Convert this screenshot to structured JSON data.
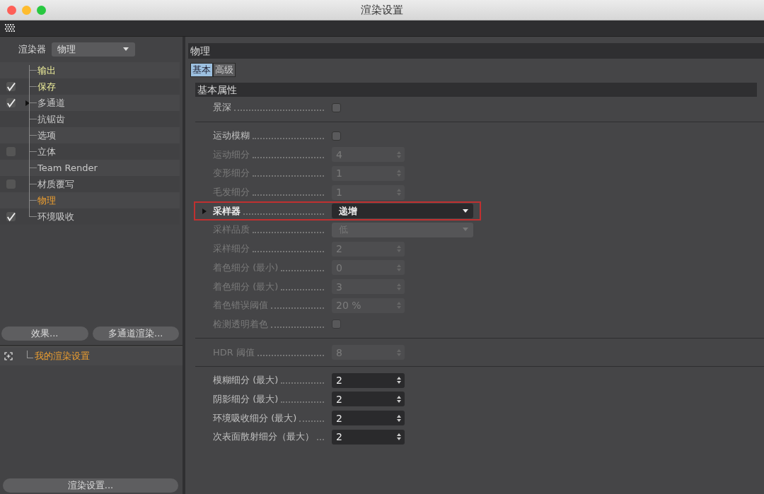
{
  "window": {
    "title": "渲染设置"
  },
  "renderer": {
    "label": "渲染器",
    "value": "物理"
  },
  "sidebar": {
    "items": [
      {
        "label": "输出",
        "kind": "plain",
        "highlighted": true,
        "selected": false
      },
      {
        "label": "保存",
        "kind": "toggle",
        "checked": true,
        "highlighted": true,
        "selected": false
      },
      {
        "label": "多通道",
        "kind": "toggle",
        "checked": true,
        "highlighted": false,
        "selected": false,
        "expandable": true
      },
      {
        "label": "抗锯齿",
        "kind": "plain",
        "highlighted": false,
        "selected": false
      },
      {
        "label": "选项",
        "kind": "plain",
        "highlighted": false,
        "selected": false
      },
      {
        "label": "立体",
        "kind": "toggle",
        "checked": false,
        "highlighted": false,
        "selected": false
      },
      {
        "label": "Team Render",
        "kind": "plain",
        "highlighted": false,
        "selected": false
      },
      {
        "label": "材质覆写",
        "kind": "toggle",
        "checked": false,
        "highlighted": false,
        "selected": false
      },
      {
        "label": "物理",
        "kind": "plain",
        "highlighted": false,
        "selected": true
      },
      {
        "label": "环境吸收",
        "kind": "toggle",
        "checked": true,
        "highlighted": false,
        "selected": false
      }
    ],
    "buttons": [
      "效果...",
      "多通道渲染..."
    ],
    "presets": [
      {
        "label": "我的渲染设置",
        "selected": true
      }
    ],
    "bottom_button": "渲染设置..."
  },
  "panel": {
    "title": "物理",
    "tabs": [
      {
        "label": "基本",
        "selected": true
      },
      {
        "label": "高级",
        "selected": false
      }
    ],
    "section": "基本属性",
    "groups": [
      [
        {
          "label": "景深",
          "kind": "checkbox",
          "checked": false,
          "disabled": false
        }
      ],
      [
        {
          "label": "运动模糊",
          "kind": "checkbox",
          "checked": false,
          "disabled": false
        },
        {
          "label": "运动细分",
          "kind": "spinner",
          "value": "4",
          "disabled": true
        },
        {
          "label": "变形细分",
          "kind": "spinner",
          "value": "1",
          "disabled": true
        },
        {
          "label": "毛发细分",
          "kind": "spinner",
          "value": "1",
          "disabled": true
        },
        {
          "label": "采样器",
          "kind": "dropdown",
          "value": "递增",
          "disabled": false,
          "expandable": true,
          "outlined": true
        },
        {
          "label": "采样品质",
          "kind": "dropdown",
          "value": "低",
          "disabled": true
        },
        {
          "label": "采样细分",
          "kind": "spinner",
          "value": "2",
          "disabled": true
        },
        {
          "label": "着色细分 (最小)",
          "kind": "spinner",
          "value": "0",
          "disabled": true
        },
        {
          "label": "着色细分 (最大)",
          "kind": "spinner",
          "value": "3",
          "disabled": true
        },
        {
          "label": "着色错误阈值",
          "kind": "spinner",
          "value": "20 %",
          "disabled": true
        },
        {
          "label": "检测透明着色",
          "kind": "checkbox",
          "checked": false,
          "disabled": true
        }
      ],
      [
        {
          "label": "HDR 阈值",
          "kind": "spinner",
          "value": "8",
          "disabled": true
        }
      ],
      [
        {
          "label": "模糊细分 (最大)",
          "kind": "spinner",
          "value": "2",
          "disabled": false
        },
        {
          "label": "阴影细分 (最大)",
          "kind": "spinner",
          "value": "2",
          "disabled": false
        },
        {
          "label": "环境吸收细分 (最大)",
          "kind": "spinner",
          "value": "2",
          "disabled": false
        },
        {
          "label": "次表面散射细分（最大）",
          "kind": "spinner",
          "value": "2",
          "disabled": false
        }
      ]
    ]
  }
}
